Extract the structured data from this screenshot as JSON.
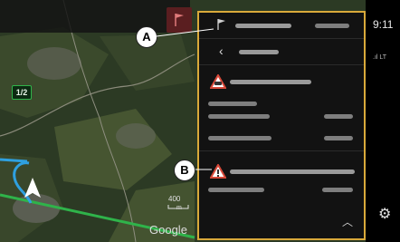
{
  "map": {
    "lane_badge": "1/2",
    "scale_value": "400",
    "scale_unit": "m",
    "attribution": "Google"
  },
  "status_bar": {
    "time": "9:11",
    "signal": "LT"
  },
  "callouts": {
    "a": "A",
    "b": "B"
  },
  "icons": [
    "flag-icon",
    "back-chevron-icon",
    "traffic-warning-icon",
    "chevron-up-icon",
    "gear-icon",
    "navigation-arrow-icon"
  ],
  "colors": {
    "panel_border": "#d9a93a",
    "route": "#2fa0e0",
    "road": "#2fb34a",
    "warning": "#d94a3a"
  }
}
